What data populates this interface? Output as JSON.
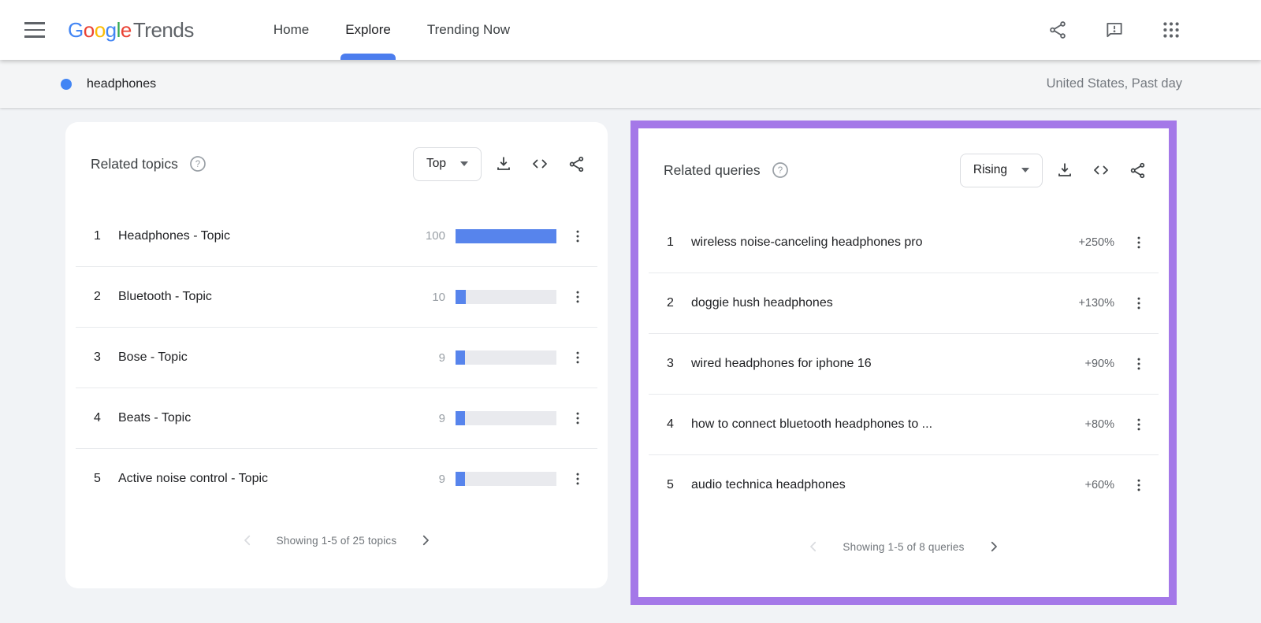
{
  "nav": {
    "logo": {
      "letters": [
        {
          "ch": "G",
          "color": "#4285F4"
        },
        {
          "ch": "o",
          "color": "#EA4335"
        },
        {
          "ch": "o",
          "color": "#FBBC05"
        },
        {
          "ch": "g",
          "color": "#4285F4"
        },
        {
          "ch": "l",
          "color": "#34A853"
        },
        {
          "ch": "e",
          "color": "#EA4335"
        }
      ],
      "suffix": "Trends"
    },
    "tabs": [
      {
        "label": "Home",
        "active": false
      },
      {
        "label": "Explore",
        "active": true
      },
      {
        "label": "Trending Now",
        "active": false
      }
    ],
    "icons": [
      "share-icon",
      "feedback-icon",
      "apps-grid-icon"
    ],
    "active_tab_underline_color": "#4c7dee"
  },
  "term_bar": {
    "term": "headphones",
    "dot_color": "#4285f4",
    "scope": "United States, Past day"
  },
  "cards": {
    "topics": {
      "title": "Related topics",
      "filter_label": "Top",
      "bar_color": "#5784ec",
      "items": [
        {
          "rank": "1",
          "label": "Headphones - Topic",
          "value": 100
        },
        {
          "rank": "2",
          "label": "Bluetooth - Topic",
          "value": 10
        },
        {
          "rank": "3",
          "label": "Bose - Topic",
          "value": 9
        },
        {
          "rank": "4",
          "label": "Beats - Topic",
          "value": 9
        },
        {
          "rank": "5",
          "label": "Active noise control - Topic",
          "value": 9
        }
      ],
      "pagination": "Showing 1-5 of 25 topics"
    },
    "queries": {
      "title": "Related queries",
      "filter_label": "Rising",
      "highlight_color": "#a478e8",
      "items": [
        {
          "rank": "1",
          "label": "wireless noise-canceling headphones pro",
          "value": "+250%"
        },
        {
          "rank": "2",
          "label": "doggie hush headphones",
          "value": "+130%"
        },
        {
          "rank": "3",
          "label": "wired headphones for iphone 16",
          "value": "+90%"
        },
        {
          "rank": "4",
          "label": "how to connect bluetooth headphones to ...",
          "value": "+80%"
        },
        {
          "rank": "5",
          "label": "audio technica headphones",
          "value": "+60%"
        }
      ],
      "pagination": "Showing 1-5 of 8 queries"
    }
  }
}
